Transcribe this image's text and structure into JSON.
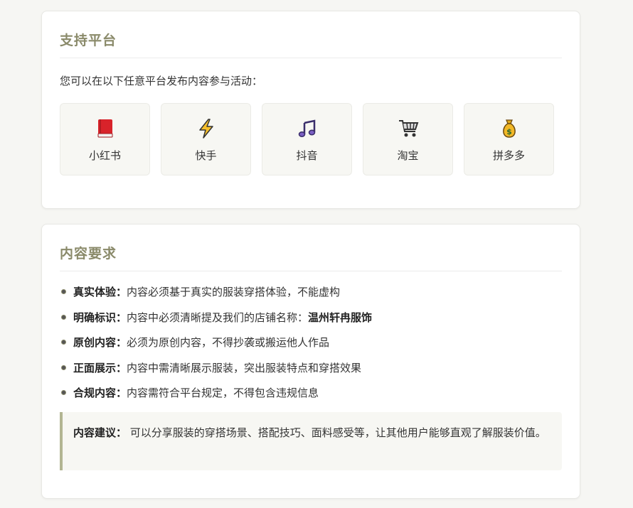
{
  "platforms_section": {
    "title": "支持平台",
    "intro": "您可以在以下任意平台发布内容参与活动：",
    "platforms": [
      {
        "label": "小红书",
        "icon": "red-book-icon"
      },
      {
        "label": "快手",
        "icon": "lightning-icon"
      },
      {
        "label": "抖音",
        "icon": "music-note-icon"
      },
      {
        "label": "淘宝",
        "icon": "shopping-cart-icon"
      },
      {
        "label": "拼多多",
        "icon": "money-bag-icon"
      }
    ]
  },
  "requirements_section": {
    "title": "内容要求",
    "items": [
      {
        "label": "真实体验：",
        "text": "内容必须基于真实的服装穿搭体验，不能虚构",
        "highlight": ""
      },
      {
        "label": "明确标识：",
        "text": "内容中必须清晰提及我们的店铺名称：",
        "highlight": "温州轩冉服饰"
      },
      {
        "label": "原创内容：",
        "text": "必须为原创内容，不得抄袭或搬运他人作品",
        "highlight": ""
      },
      {
        "label": "正面展示：",
        "text": "内容中需清晰展示服装，突出服装特点和穿搭效果",
        "highlight": ""
      },
      {
        "label": "合规内容：",
        "text": "内容需符合平台规定，不得包含违规信息",
        "highlight": ""
      }
    ],
    "tip": {
      "label": "内容建议：",
      "text": " 可以分享服装的穿搭场景、搭配技巧、面料感受等，让其他用户能够直观了解服装价值。"
    }
  }
}
